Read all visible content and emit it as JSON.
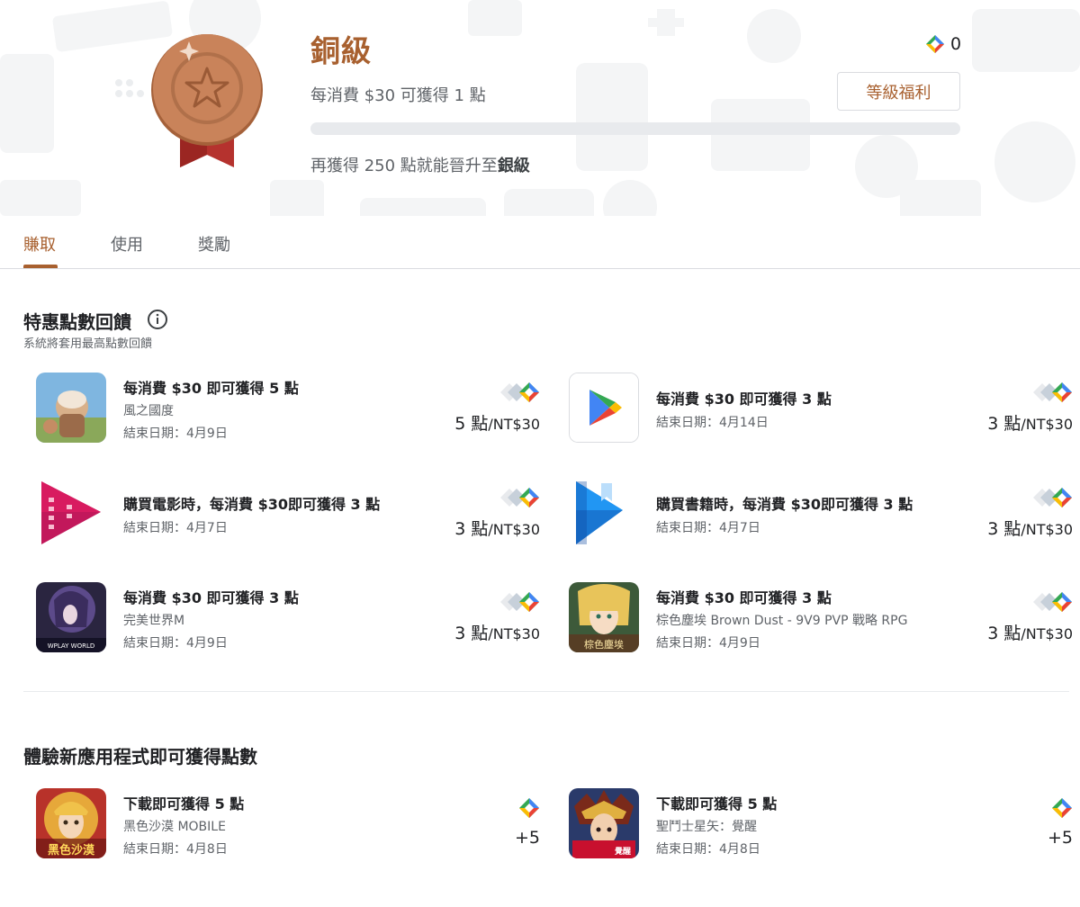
{
  "header": {
    "tier_name": "銅級",
    "rate_text": "每消費 $30 可獲得 1 點",
    "points_balance": "0",
    "benefits_button": "等級福利",
    "progress_fraction": 0,
    "upgrade_prefix": "再獲得 250 點就能晉升至",
    "upgrade_tier": "銀級",
    "accent_color": "#a8602f"
  },
  "tabs": [
    {
      "label": "賺取",
      "active": true
    },
    {
      "label": "使用",
      "active": false
    },
    {
      "label": "獎勵",
      "active": false
    }
  ],
  "special_section": {
    "title": "特惠點數回饋",
    "subtitle": "系統將套用最高點數回饋",
    "offers": [
      {
        "icon": "wind-kingdom-game-icon",
        "headline": "每消費 $30 即可獲得 5 點",
        "app": "風之國度",
        "end_date": "結束日期：4月9日",
        "rate_points": "5 點",
        "rate_unit": "/NT$30"
      },
      {
        "icon": "google-play-icon",
        "headline": "每消費 $30 即可獲得 3 點",
        "app": "",
        "end_date": "結束日期：4月14日",
        "rate_points": "3 點",
        "rate_unit": "/NT$30"
      },
      {
        "icon": "play-movies-icon",
        "headline": "購買電影時，每消費 $30即可獲得 3 點",
        "app": "",
        "end_date": "結束日期：4月7日",
        "rate_points": "3 點",
        "rate_unit": "/NT$30"
      },
      {
        "icon": "play-books-icon",
        "headline": "購買書籍時，每消費 $30即可獲得 3 點",
        "app": "",
        "end_date": "結束日期：4月7日",
        "rate_points": "3 點",
        "rate_unit": "/NT$30"
      },
      {
        "icon": "perfect-world-game-icon",
        "headline": "每消費 $30 即可獲得 3 點",
        "app": "完美世界M",
        "end_date": "結束日期：4月9日",
        "rate_points": "3 點",
        "rate_unit": "/NT$30",
        "icon_caption": "WPLAY WORLD"
      },
      {
        "icon": "brown-dust-game-icon",
        "headline": "每消費 $30 即可獲得 3 點",
        "app": "棕色塵埃 Brown Dust - 9V9 PVP 戰略 RPG",
        "end_date": "結束日期：4月9日",
        "rate_points": "3 點",
        "rate_unit": "/NT$30",
        "icon_caption": "棕色塵埃"
      }
    ]
  },
  "new_apps_section": {
    "title": "體驗新應用程式即可獲得點數",
    "offers": [
      {
        "icon": "black-desert-game-icon",
        "headline": "下載即可獲得 5 點",
        "app": "黑色沙漠 MOBILE",
        "end_date": "結束日期：4月8日",
        "bonus": "+5",
        "icon_caption": "黑色沙漠"
      },
      {
        "icon": "saint-seiya-game-icon",
        "headline": "下載即可獲得 5 點",
        "app": "聖鬥士星矢：覺醒",
        "end_date": "結束日期：4月8日",
        "bonus": "+5",
        "icon_caption": "覺醒"
      }
    ]
  }
}
